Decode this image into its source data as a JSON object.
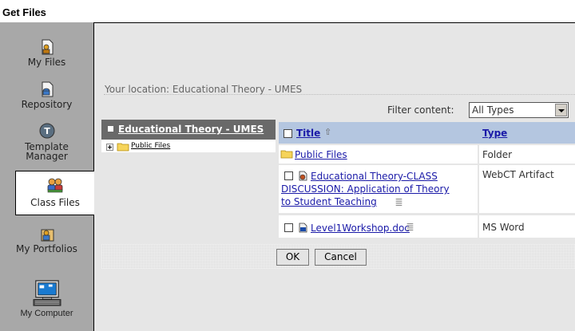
{
  "window": {
    "title": "Get Files"
  },
  "sidebar": {
    "items": [
      {
        "id": "my-files",
        "label": "My Files",
        "icon": "my-files-icon"
      },
      {
        "id": "repository",
        "label": "Repository",
        "icon": "repository-icon"
      },
      {
        "id": "template-manager",
        "label_line1": "Template",
        "label_line2": "Manager",
        "icon": "template-manager-icon"
      },
      {
        "id": "class-files",
        "label": "Class Files",
        "icon": "class-files-icon",
        "selected": true
      },
      {
        "id": "my-portfolios",
        "label": "My Portfolios",
        "icon": "my-portfolios-icon"
      },
      {
        "id": "my-computer",
        "label": "My Computer",
        "icon": "my-computer-icon"
      }
    ]
  },
  "location": {
    "text": "Your location: Educational Theory - UMES"
  },
  "filter": {
    "label": "Filter content:",
    "selected": "All Types"
  },
  "tree": {
    "title": "Educational Theory - UMES",
    "children": [
      {
        "label": "Public Files",
        "icon": "folder-icon"
      }
    ]
  },
  "files": {
    "columns": {
      "title": "Title",
      "type": "Type"
    },
    "rows": [
      {
        "title": "Public Files",
        "type": "Folder",
        "icon": "folder-icon"
      },
      {
        "title_line1": "Educational Theory-CLASS",
        "title_line2": "DISCUSSION: Application of Theory",
        "title_line3": "to Student Teaching",
        "type": "WebCT Artifact",
        "icon": "webct-artifact-icon"
      },
      {
        "title": "Level1Workshop.doc",
        "type": "MS Word",
        "icon": "word-doc-icon"
      }
    ]
  },
  "buttons": {
    "ok": "OK",
    "cancel": "Cancel"
  },
  "colors": {
    "sidebar": "#a8a8a8",
    "content_bg": "#e6e6e6",
    "tree_header": "#696969",
    "table_header": "#b4c6e0",
    "link": "#1a1aa8"
  }
}
